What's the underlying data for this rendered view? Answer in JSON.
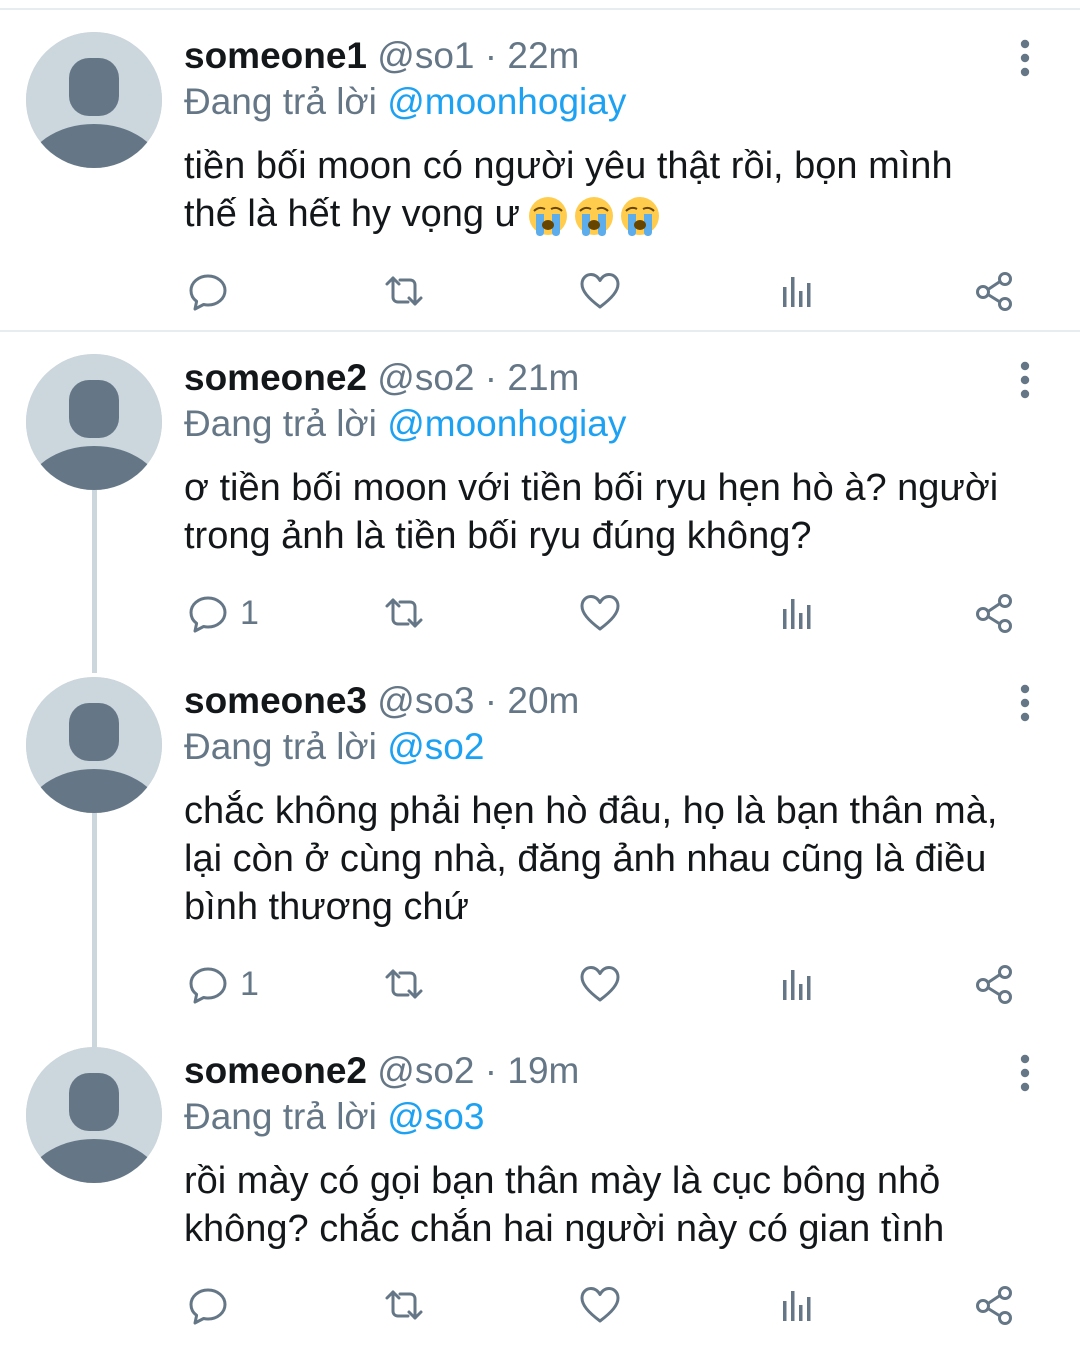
{
  "tweets": [
    {
      "name": "someone1",
      "handle": "@so1",
      "separator": "·",
      "time": "22m",
      "reply_prefix": "Đang trả lời",
      "reply_to": "@moonhogiay",
      "text_lines": [
        "tiền bối moon có người yêu thật rồi, bọn mình",
        "thế là hết hy vọng ư"
      ],
      "emojis": [
        "loudly-crying-face",
        "loudly-crying-face",
        "loudly-crying-face"
      ],
      "reply_count": ""
    },
    {
      "name": "someone2",
      "handle": "@so2",
      "separator": "·",
      "time": "21m",
      "reply_prefix": "Đang trả lời",
      "reply_to": "@moonhogiay",
      "text_lines": [
        "ơ tiền bối moon với tiền bối ryu hẹn hò à? người",
        "trong ảnh là tiền bối ryu đúng không?"
      ],
      "reply_count": "1"
    },
    {
      "name": "someone3",
      "handle": "@so3",
      "separator": "·",
      "time": "20m",
      "reply_prefix": "Đang trả lời",
      "reply_to": "@so2",
      "text_lines": [
        "chắc không phải hẹn hò đâu, họ là bạn thân mà,",
        "lại còn ở cùng nhà, đăng ảnh nhau cũng là điều",
        "bình thương chứ"
      ],
      "reply_count": "1"
    },
    {
      "name": "someone2",
      "handle": "@so2",
      "separator": "·",
      "time": "19m",
      "reply_prefix": "Đang trả lời",
      "reply_to": "@so3",
      "text_lines": [
        "rồi mày có gọi bạn thân mày là cục bông nhỏ",
        "không? chắc chắn hai người này có gian tình"
      ],
      "reply_count": ""
    }
  ],
  "colors": {
    "text": "#14171a",
    "secondary": "#657786",
    "mention": "#1da1f2",
    "avatar_bg": "#ccd6dd",
    "avatar_fg": "#657786",
    "divider": "#e6ecf0"
  },
  "icons": [
    "reply-icon",
    "retweet-icon",
    "like-icon",
    "analytics-icon",
    "share-icon",
    "more-vertical-icon"
  ]
}
